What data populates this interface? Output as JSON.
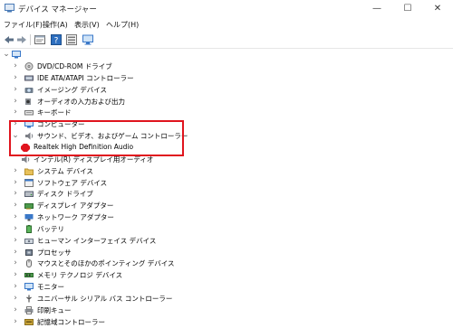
{
  "window": {
    "title": "デバイス マネージャー",
    "controls": {
      "minimize": "—",
      "maximize": "☐",
      "close": "✕"
    }
  },
  "menu": [
    {
      "label": "ファイル(F)"
    },
    {
      "label": "操作(A)"
    },
    {
      "label": "表示(V)"
    },
    {
      "label": "ヘルプ(H)"
    }
  ],
  "toolbar": [
    {
      "icon": "back-arrow-icon"
    },
    {
      "icon": "forward-arrow-icon"
    },
    {
      "icon": "properties-icon"
    },
    {
      "icon": "help-icon"
    },
    {
      "icon": "device-list-icon"
    },
    {
      "icon": "monitor-icon"
    }
  ],
  "tree": {
    "root_chevron": "⌄",
    "items": [
      {
        "label": "DVD/CD-ROM ドライブ",
        "icon": "dvd-icon",
        "chevron": "›"
      },
      {
        "label": "IDE ATA/ATAPI コントローラー",
        "icon": "ide-controller-icon",
        "chevron": "›"
      },
      {
        "label": "イメージング デバイス",
        "icon": "camera-icon",
        "chevron": "›"
      },
      {
        "label": "オーディオの入力および出力",
        "icon": "speaker-icon",
        "chevron": "›"
      },
      {
        "label": "キーボード",
        "icon": "keyboard-icon",
        "chevron": "›"
      },
      {
        "label": "コンピューター",
        "icon": "computer-icon",
        "chevron": "›"
      },
      {
        "label": "サウンド、ビデオ、およびゲーム コントローラー",
        "icon": "sound-icon",
        "chevron": "⌄",
        "expanded": true
      },
      {
        "label": "Realtek High Definition Audio",
        "icon": "error-icon",
        "child": true
      },
      {
        "label": "インテル(R) ディスプレイ用オーディオ",
        "icon": "sound-icon",
        "child": true
      },
      {
        "label": "システム デバイス",
        "icon": "folder-icon",
        "chevron": "›"
      },
      {
        "label": "ソフトウェア デバイス",
        "icon": "software-icon",
        "chevron": "›"
      },
      {
        "label": "ディスク ドライブ",
        "icon": "disk-icon",
        "chevron": "›"
      },
      {
        "label": "ディスプレイ アダプター",
        "icon": "display-adapter-icon",
        "chevron": "›"
      },
      {
        "label": "ネットワーク アダプター",
        "icon": "network-icon",
        "chevron": "›"
      },
      {
        "label": "バッテリ",
        "icon": "battery-icon",
        "chevron": "›"
      },
      {
        "label": "ヒューマン インターフェイス デバイス",
        "icon": "hid-icon",
        "chevron": "›"
      },
      {
        "label": "プロセッサ",
        "icon": "processor-icon",
        "chevron": "›"
      },
      {
        "label": "マウスとそのほかのポインティング デバイス",
        "icon": "mouse-icon",
        "chevron": "›"
      },
      {
        "label": "メモリ テクノロジ デバイス",
        "icon": "memory-icon",
        "chevron": "›"
      },
      {
        "label": "モニター",
        "icon": "monitor-icon",
        "chevron": "›"
      },
      {
        "label": "ユニバーサル シリアル バス コントローラー",
        "icon": "usb-icon",
        "chevron": "›"
      },
      {
        "label": "印刷キュー",
        "icon": "printer-icon",
        "chevron": "›"
      },
      {
        "label": "記憶域コントローラー",
        "icon": "storage-icon",
        "chevron": "›"
      }
    ]
  },
  "colors": {
    "highlight_border": "#e0141e",
    "error_icon": "#e0141e",
    "folder": "#e8c15a",
    "device_blue": "#3a78c8"
  }
}
